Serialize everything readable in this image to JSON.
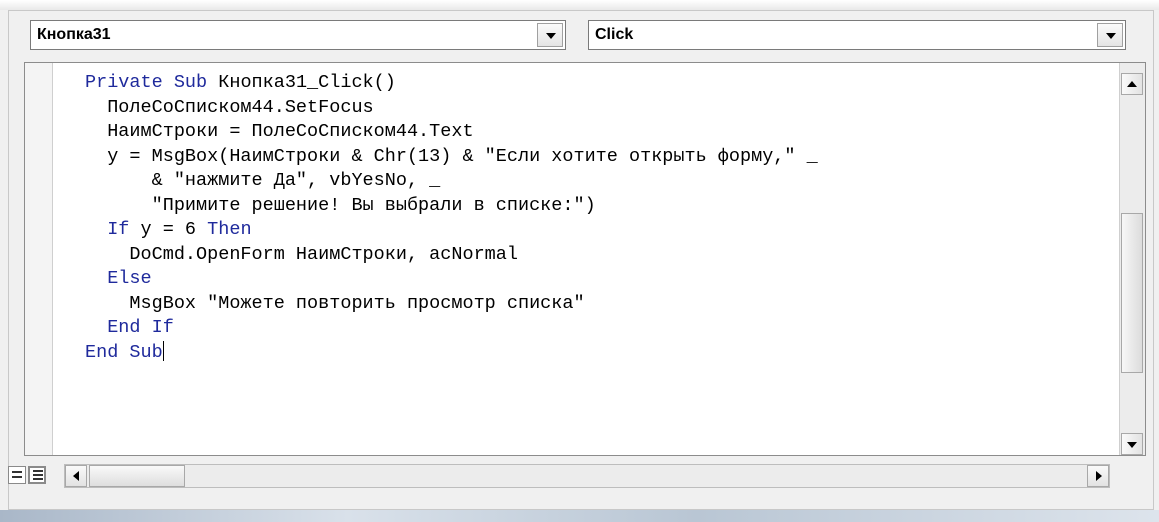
{
  "object_combo": {
    "value": "Кнопка31",
    "icon": "chevron-down-icon"
  },
  "procedure_combo": {
    "value": "Click",
    "icon": "chevron-down-icon"
  },
  "code_editor": {
    "lines": [
      [
        {
          "t": "Private Sub ",
          "k": true
        },
        {
          "t": "Кнопка31_Click()",
          "k": false
        }
      ],
      [
        {
          "t": "  ПолеСоСписком44.SetFocus",
          "k": false
        }
      ],
      [
        {
          "t": "  НаимСтроки = ПолеСоСписком44.Text",
          "k": false
        }
      ],
      [
        {
          "t": "  y = MsgBox(НаимСтроки & Chr(13) & \"Если хотите открыть форму,\" _",
          "k": false
        }
      ],
      [
        {
          "t": "      & \"нажмите Да\", vbYesNo, _",
          "k": false
        }
      ],
      [
        {
          "t": "      \"Примите решение! Вы выбрали в списке:\")",
          "k": false
        }
      ],
      [
        {
          "t": "  If ",
          "k": true
        },
        {
          "t": "y = 6 ",
          "k": false
        },
        {
          "t": "Then",
          "k": true
        }
      ],
      [
        {
          "t": "    DoCmd.OpenForm НаимСтроки, acNormal",
          "k": false
        }
      ],
      [
        {
          "t": "  Else",
          "k": true
        }
      ],
      [
        {
          "t": "    MsgBox \"Можете повторить просмотр списка\"",
          "k": false
        }
      ],
      [
        {
          "t": "  End If",
          "k": true
        }
      ],
      [
        {
          "t": "End Sub",
          "k": true
        }
      ]
    ],
    "keyword_color": "#1f2a9c"
  },
  "scrollbars": {
    "vertical_up_icon": "arrow-up-icon",
    "vertical_down_icon": "arrow-down-icon",
    "horizontal_left_icon": "arrow-left-icon",
    "horizontal_right_icon": "arrow-right-icon"
  },
  "view_buttons": [
    {
      "icon": "procedure-view-icon"
    },
    {
      "icon": "full-module-view-icon"
    }
  ]
}
